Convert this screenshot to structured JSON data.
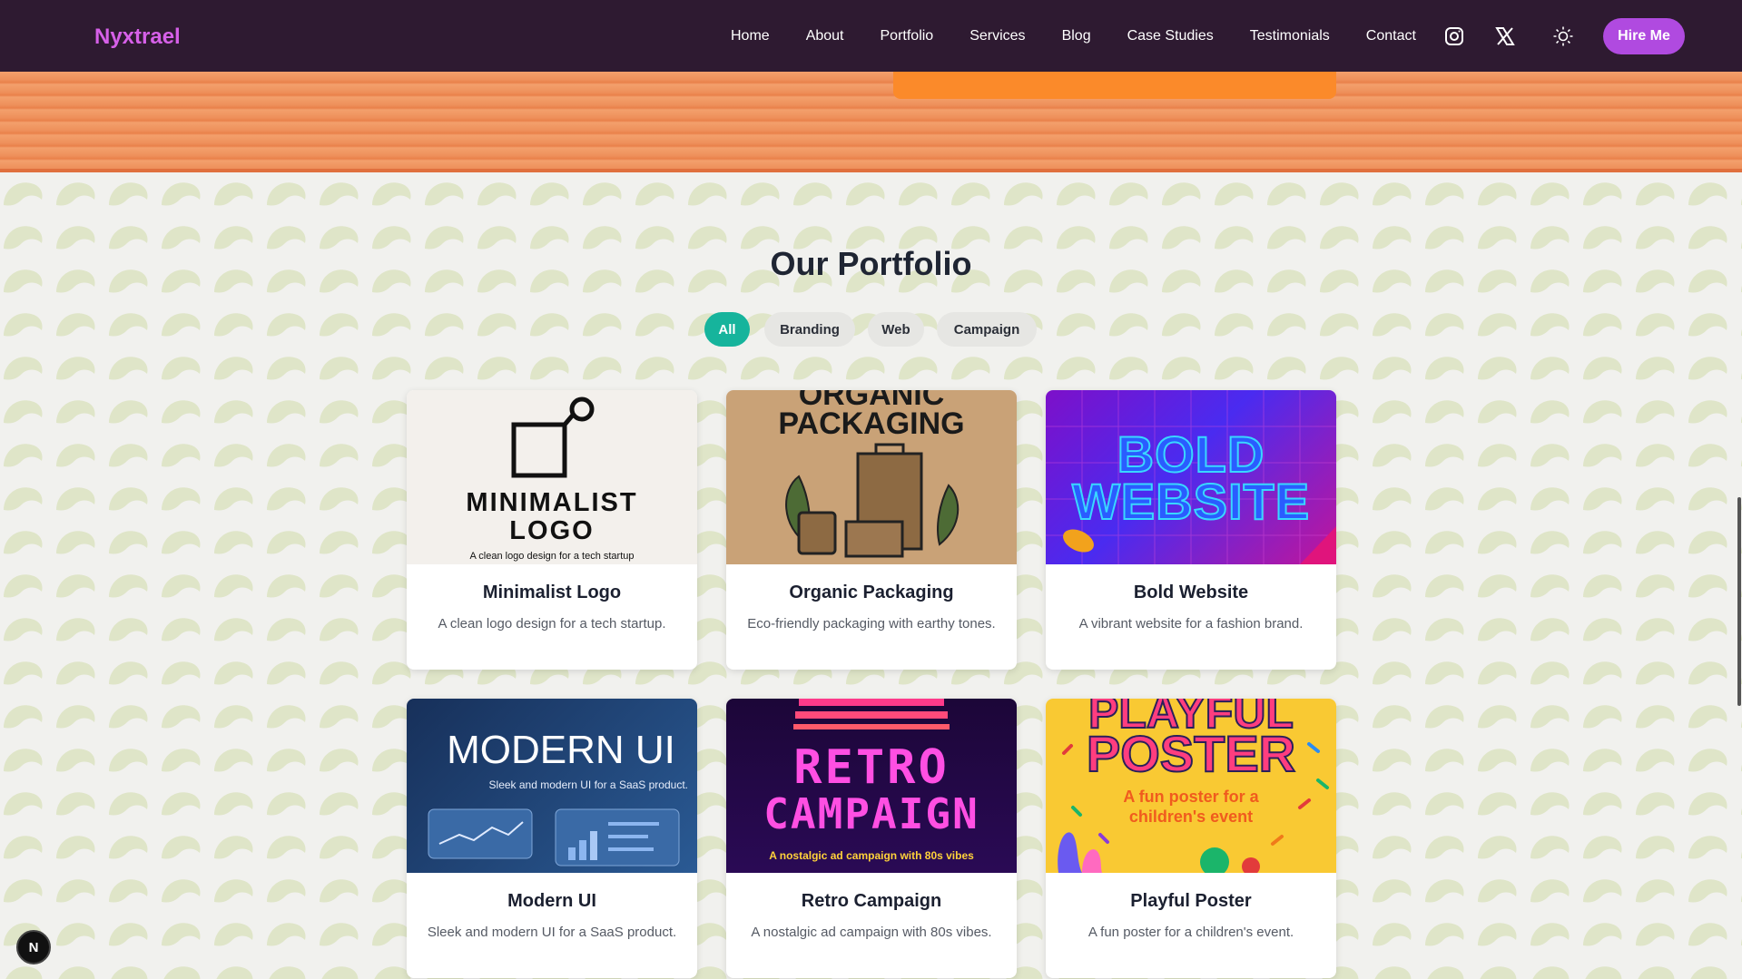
{
  "header": {
    "brand": "Nyxtrael",
    "nav": [
      "Home",
      "About",
      "Portfolio",
      "Services",
      "Blog",
      "Case Studies",
      "Testimonials",
      "Contact"
    ],
    "icons": [
      "instagram-icon",
      "x-icon",
      "sun-icon"
    ],
    "cta": "Hire Me"
  },
  "portfolio": {
    "title": "Our Portfolio",
    "filters": [
      "All",
      "Branding",
      "Web",
      "Campaign"
    ],
    "active_filter": "All",
    "items": [
      {
        "title": "Minimalist Logo",
        "description": "A clean logo design for a tech startup.",
        "image_heading_1": "MINIMALIST",
        "image_heading_2": "LOGO",
        "image_caption": "A clean logo design for a tech startup"
      },
      {
        "title": "Organic Packaging",
        "description": "Eco-friendly packaging with earthy tones.",
        "image_heading_1": "ORGANIC",
        "image_heading_2": "PACKAGING"
      },
      {
        "title": "Bold Website",
        "description": "A vibrant website for a fashion brand.",
        "image_heading_1": "BOLD",
        "image_heading_2": "WEBSITE"
      },
      {
        "title": "Modern UI",
        "description": "Sleek and modern UI for a SaaS product.",
        "image_heading_1": "MODERN UI",
        "image_caption": "Sleek and modern UI for a SaaS product."
      },
      {
        "title": "Retro Campaign",
        "description": "A nostalgic ad campaign with 80s vibes.",
        "image_heading_1": "RETRO",
        "image_heading_2": "CAMPAIGN",
        "image_caption": "A nostalgic ad campaign with 80s vibes"
      },
      {
        "title": "Playful Poster",
        "description": "A fun poster for a children's event.",
        "image_heading_1": "PLAYFUL",
        "image_heading_2": "POSTER",
        "image_caption_1": "A fun poster for a",
        "image_caption_2": "children's event"
      }
    ]
  },
  "badge": "N",
  "colors": {
    "nav_bg": "#2e1a31",
    "brand": "#d660e8",
    "cta": "#b04ae0",
    "filter_active": "#16b49c",
    "stripe": "#ee8f5a",
    "accent_bar": "#fb8a2a",
    "pattern": "#dfe5c8"
  }
}
